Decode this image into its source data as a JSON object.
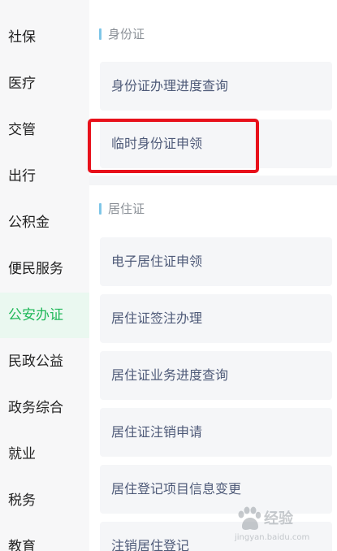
{
  "sidebar": {
    "items": [
      {
        "label": "社保"
      },
      {
        "label": "医疗"
      },
      {
        "label": "交管"
      },
      {
        "label": "出行"
      },
      {
        "label": "公积金"
      },
      {
        "label": "便民服务"
      },
      {
        "label": "公安办证",
        "active": true
      },
      {
        "label": "民政公益"
      },
      {
        "label": "政务综合"
      },
      {
        "label": "就业"
      },
      {
        "label": "税务"
      },
      {
        "label": "教育"
      }
    ],
    "active_color": "#21b85a",
    "active_background": "#eaf8f0"
  },
  "sections": [
    {
      "title": "身份证",
      "items": [
        {
          "label": "身份证办理进度查询"
        },
        {
          "label": "临时身份证申领",
          "highlighted": true
        }
      ]
    },
    {
      "title": "居住证",
      "items": [
        {
          "label": "电子居住证申领"
        },
        {
          "label": "居住证签注办理"
        },
        {
          "label": "居住证业务进度查询"
        },
        {
          "label": "居住证注销申请"
        },
        {
          "label": "居住登记项目信息变更"
        },
        {
          "label": "注销居住登记"
        }
      ]
    }
  ],
  "highlight_color": "#e8111b",
  "watermark": {
    "text": "经验",
    "url": "jingyan.baidu.com"
  }
}
